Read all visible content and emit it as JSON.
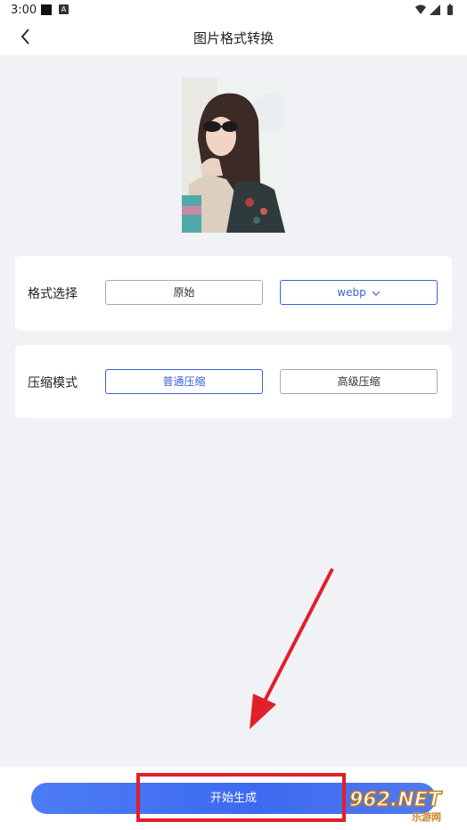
{
  "status_bar": {
    "time": "3:00",
    "notification_icon": "A"
  },
  "header": {
    "title": "图片格式转换"
  },
  "format_card": {
    "label": "格式选择",
    "original_option": "原始",
    "selected_format": "webp"
  },
  "compression_card": {
    "label": "压缩模式",
    "normal_option": "普通压缩",
    "advanced_option": "高级压缩"
  },
  "primary_action": {
    "label": "开始生成"
  },
  "watermark": {
    "brand": "962.NET",
    "sub": "乐游网"
  },
  "colors": {
    "accent": "#3b63d9",
    "button_blue": "#4d7cf5",
    "highlight_red": "#e0202a",
    "page_background": "#f0f2f5"
  }
}
